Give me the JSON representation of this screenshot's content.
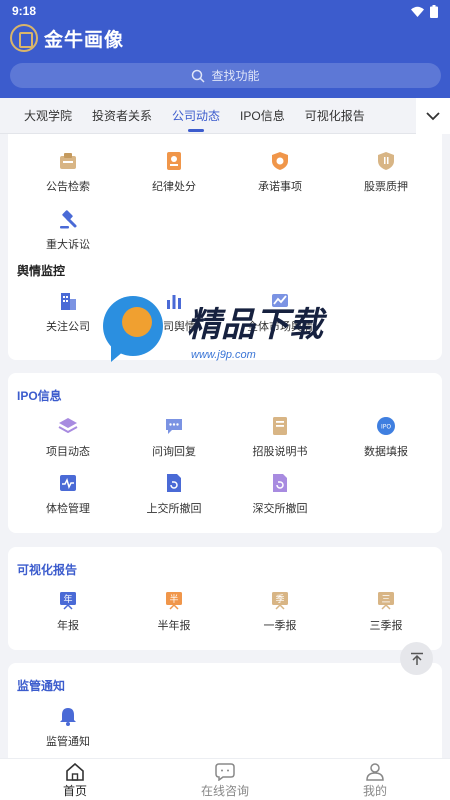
{
  "status": {
    "time": "9:18"
  },
  "app": {
    "title": "金牛画像"
  },
  "search": {
    "placeholder": "查找功能"
  },
  "tabs": [
    {
      "label": "大观学院",
      "active": false
    },
    {
      "label": "投资者关系",
      "active": false
    },
    {
      "label": "公司动态",
      "active": true
    },
    {
      "label": "IPO信息",
      "active": false
    },
    {
      "label": "可视化报告",
      "active": false
    }
  ],
  "company": {
    "items": [
      {
        "label": "公告检索",
        "icon": "announcement-icon"
      },
      {
        "label": "纪律处分",
        "icon": "discipline-icon"
      },
      {
        "label": "承诺事项",
        "icon": "commitment-icon"
      },
      {
        "label": "股票质押",
        "icon": "pledge-icon"
      },
      {
        "label": "重大诉讼",
        "icon": "gavel-icon"
      }
    ],
    "sentiment_title": "舆情监控",
    "sentiment_items": [
      {
        "label": "关注公司",
        "icon": "building-icon"
      },
      {
        "label": "公司舆情",
        "icon": "chart-icon"
      },
      {
        "label": "全体市场舆情",
        "icon": "market-icon"
      }
    ]
  },
  "ipo": {
    "title": "IPO信息",
    "items": [
      {
        "label": "项目动态",
        "icon": "layers-icon"
      },
      {
        "label": "问询回复",
        "icon": "chat-icon"
      },
      {
        "label": "招股说明书",
        "icon": "book-icon"
      },
      {
        "label": "数据填报",
        "icon": "ipo-icon"
      },
      {
        "label": "体检管理",
        "icon": "checkup-icon"
      },
      {
        "label": "上交所撤回",
        "icon": "sse-withdraw-icon"
      },
      {
        "label": "深交所撤回",
        "icon": "szse-withdraw-icon"
      }
    ]
  },
  "reports": {
    "title": "可视化报告",
    "items": [
      {
        "label": "年报",
        "badge": "年",
        "color": "#4a6ad6"
      },
      {
        "label": "半年报",
        "badge": "半",
        "color": "#f0964a"
      },
      {
        "label": "一季报",
        "badge": "季",
        "color": "#d6b07e"
      },
      {
        "label": "三季报",
        "badge": "三",
        "color": "#d6b07e"
      }
    ]
  },
  "regulation": {
    "title": "监管通知",
    "items": [
      {
        "label": "监管通知",
        "icon": "bell-icon"
      }
    ]
  },
  "watermark": {
    "title": "精品下载",
    "url": "www.j9p.com"
  },
  "nav": [
    {
      "label": "首页",
      "icon": "home-icon",
      "active": true
    },
    {
      "label": "在线咨询",
      "icon": "chat-bubble-icon",
      "active": false
    },
    {
      "label": "我的",
      "icon": "user-icon",
      "active": false
    }
  ]
}
